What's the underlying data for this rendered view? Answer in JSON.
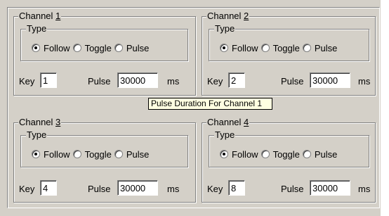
{
  "channels": [
    {
      "title_prefix": "Channel ",
      "number": "1",
      "type_label": "Type",
      "options": [
        "Follow",
        "Toggle",
        "Pulse"
      ],
      "selected": "Follow",
      "key_label": "Key",
      "key_value": "1",
      "pulse_label": "Pulse",
      "pulse_value": "30000",
      "unit": "ms"
    },
    {
      "title_prefix": "Channel ",
      "number": "2",
      "type_label": "Type",
      "options": [
        "Follow",
        "Toggle",
        "Pulse"
      ],
      "selected": "Follow",
      "key_label": "Key",
      "key_value": "2",
      "pulse_label": "Pulse",
      "pulse_value": "30000",
      "unit": "ms"
    },
    {
      "title_prefix": "Channel ",
      "number": "3",
      "type_label": "Type",
      "options": [
        "Follow",
        "Toggle",
        "Pulse"
      ],
      "selected": "Follow",
      "key_label": "Key",
      "key_value": "4",
      "pulse_label": "Pulse",
      "pulse_value": "30000",
      "unit": "ms"
    },
    {
      "title_prefix": "Channel ",
      "number": "4",
      "type_label": "Type",
      "options": [
        "Follow",
        "Toggle",
        "Pulse"
      ],
      "selected": "Follow",
      "key_label": "Key",
      "key_value": "8",
      "pulse_label": "Pulse",
      "pulse_value": "30000",
      "unit": "ms"
    }
  ],
  "tooltip": "Pulse Duration For Channel 1"
}
